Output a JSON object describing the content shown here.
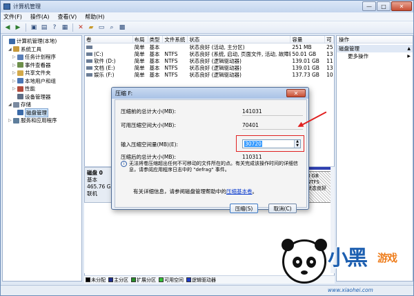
{
  "window": {
    "title": "计算机管理",
    "min": "—",
    "max": "□",
    "close": "✕"
  },
  "menu": [
    "文件(F)",
    "操作(A)",
    "查看(V)",
    "帮助(H)"
  ],
  "toolbar": {
    "icons": [
      "back-icon",
      "forward-icon",
      "up-icon",
      "properties-icon",
      "help-icon",
      "view-icon",
      "delete-icon",
      "open-icon",
      "save-icon",
      "search-icon",
      "zoom-icon"
    ]
  },
  "tree": [
    {
      "label": "计算机管理(本地)",
      "level": 0,
      "exp": "",
      "color": "#3b6aa8"
    },
    {
      "label": "系统工具",
      "level": 1,
      "exp": "◢",
      "color": "#c79a3c"
    },
    {
      "label": "任务计划程序",
      "level": 2,
      "exp": "▷",
      "color": "#5a7fb8"
    },
    {
      "label": "事件查看器",
      "level": 2,
      "exp": "▷",
      "color": "#6d8f4a"
    },
    {
      "label": "共享文件夹",
      "level": 2,
      "exp": "▷",
      "color": "#d3a94a"
    },
    {
      "label": "本地用户和组",
      "level": 2,
      "exp": "▷",
      "color": "#4b76b5"
    },
    {
      "label": "性能",
      "level": 2,
      "exp": "▷",
      "color": "#b24b3c"
    },
    {
      "label": "设备管理器",
      "level": 2,
      "exp": "",
      "color": "#5e6e86"
    },
    {
      "label": "存储",
      "level": 1,
      "exp": "◢",
      "color": "#7a8aa0"
    },
    {
      "label": "磁盘管理",
      "level": 2,
      "exp": "",
      "color": "#3b6aa8",
      "selected": true
    },
    {
      "label": "服务和应用程序",
      "level": 1,
      "exp": "▷",
      "color": "#5e7e9c"
    }
  ],
  "table": {
    "headers": [
      "卷",
      "布局",
      "类型",
      "文件系统",
      "状态",
      "容量",
      "可"
    ],
    "rows": [
      [
        "",
        "简单",
        "基本",
        "",
        "状态良好 (活动, 主分区)",
        "251 MB",
        "25"
      ],
      [
        "(C:)",
        "简单",
        "基本",
        "NTFS",
        "状态良好 (系统, 启动, 页面文件, 活动, 故障转储, 主分区)",
        "50.01 GB",
        "13"
      ],
      [
        "软件 (D:)",
        "简单",
        "基本",
        "NTFS",
        "状态良好 (逻辑驱动器)",
        "139.01 GB",
        "11"
      ],
      [
        "文档 (E:)",
        "简单",
        "基本",
        "NTFS",
        "状态良好 (逻辑驱动器)",
        "139.01 GB",
        "13"
      ],
      [
        "娱乐 (F:)",
        "简单",
        "基本",
        "NTFS",
        "状态良好 (逻辑驱动器)",
        "137.73 GB",
        "10"
      ]
    ]
  },
  "disk": {
    "name": "磁盘 0",
    "type": "基本",
    "size": "465.76 GB",
    "status": "联机",
    "part_size": "8 GB NTFS",
    "part_status": "状态良好"
  },
  "legend": [
    {
      "label": "未分配",
      "color": "#000000"
    },
    {
      "label": "主分区",
      "color": "#1f2f8f"
    },
    {
      "label": "扩展分区",
      "color": "#2a8f2a"
    },
    {
      "label": "可用空间",
      "color": "#36c036"
    },
    {
      "label": "逻辑驱动器",
      "color": "#1e3cc8"
    }
  ],
  "ops": {
    "header": "操作",
    "section": "磁盘管理",
    "section_arrow": "▲",
    "more": "更多操作",
    "more_arrow": "▶"
  },
  "dialog": {
    "title": "压缩 F:",
    "close": "✕",
    "total_label": "压缩前的总计大小(MB):",
    "total_value": "141031",
    "avail_label": "可用压缩空间大小(MB):",
    "avail_value": "70401",
    "input_label": "输入压缩空间量(MB)(E):",
    "input_value": "30720",
    "after_label": "压缩后的总计大小(MB):",
    "after_value": "110311",
    "info_icon": "i",
    "info_text": "无法将卷压缩超出任何不可移动的文件所在的点。有关完成该操作时间的详细信息，请参阅应用程序日志中的 \"defrag\" 事件。",
    "help_text": "有关详细信息，请参阅磁盘管理帮助中的",
    "help_link": "压缩基本卷",
    "help_end": "。",
    "ok": "压缩(S)",
    "cancel": "取消(C)"
  },
  "watermark": {
    "main": "小黑",
    "sub": "游戏",
    "url": "www.xiaohei.com"
  }
}
